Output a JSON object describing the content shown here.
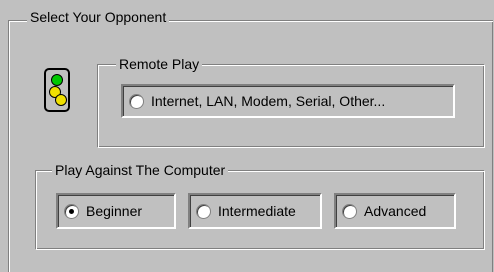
{
  "dialog": {
    "group_title": "Select Your Opponent"
  },
  "remote_play": {
    "title": "Remote Play",
    "option": {
      "label": "Internet, LAN, Modem, Serial, Other...",
      "checked": false
    }
  },
  "computer_play": {
    "title": "Play Against The Computer",
    "options": [
      {
        "label": "Beginner",
        "checked": true
      },
      {
        "label": "Intermediate",
        "checked": false
      },
      {
        "label": "Advanced",
        "checked": false
      }
    ]
  },
  "icons": {
    "connection": "network-signal-icon"
  },
  "colors": {
    "background": "#c0c0c0",
    "icon_green": "#00c800",
    "icon_yellow": "#f0e000"
  }
}
